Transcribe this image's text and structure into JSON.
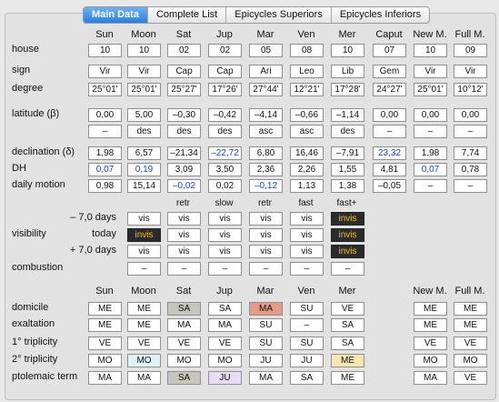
{
  "tabs": [
    "Main Data",
    "Complete List",
    "Epicycles Superiors",
    "Epicycles Inferiors"
  ],
  "columns": [
    "Sun",
    "Moon",
    "Sat",
    "Jup",
    "Mar",
    "Ven",
    "Mer",
    "Caput",
    "New M.",
    "Full M."
  ],
  "labels": {
    "house": "house",
    "sign": "sign",
    "degree": "degree",
    "latitude": "latitude (β)",
    "declination": "declination (δ)",
    "dh": "DH",
    "daily_motion": "daily motion",
    "visibility": "visibility",
    "combustion": "combustion"
  },
  "sublabels": {
    "minus": "– 7,0 days",
    "today": "today",
    "plus": "+ 7,0 days"
  },
  "rows": {
    "house": [
      "10",
      "10",
      "02",
      "02",
      "05",
      "08",
      "10",
      "07",
      "10",
      "09"
    ],
    "sign": [
      "Vir",
      "Vir",
      "Cap",
      "Cap",
      "Ari",
      "Leo",
      "Lib",
      "Gem",
      "Vir",
      "Vir"
    ],
    "degree": [
      "25°01'",
      "25°01'",
      "25°27'",
      "17°26'",
      "27°44'",
      "12°21'",
      "17°28'",
      "24°27'",
      "25°01'",
      "10°12'"
    ],
    "latitude": [
      "0,00",
      "5,00",
      "–0,30",
      "–0,42",
      "–4,14",
      "–0,66",
      "–1,14",
      "0,00",
      "0,00",
      "0,00"
    ],
    "latitude_dir": [
      "–",
      "des",
      "des",
      "des",
      "asc",
      "asc",
      "des",
      "–",
      "–",
      "–"
    ],
    "declination": [
      "1,98",
      "6,57",
      "–21,34",
      "–22,72",
      "6,80",
      "16,46",
      "–7,91",
      "23,32",
      "1,98",
      "7,74"
    ],
    "dh": [
      "0,07",
      "0,19",
      "3,09",
      "3,50",
      "2,36",
      "2,26",
      "1,55",
      "4,81",
      "0,07",
      "0,78"
    ],
    "daily_motion": [
      "0,98",
      "15,14",
      "–0,02",
      "0,02",
      "–0,12",
      "1,13",
      "1,38",
      "–0,05",
      "–",
      "–"
    ],
    "motion_state": [
      "",
      "",
      "retr",
      "slow",
      "retr",
      "fast",
      "fast+",
      "",
      "",
      ""
    ],
    "vis_minus": [
      "vis",
      "vis",
      "vis",
      "vis",
      "vis",
      "invis"
    ],
    "vis_today": [
      "invis",
      "vis",
      "vis",
      "vis",
      "vis",
      "invis"
    ],
    "vis_plus": [
      "vis",
      "vis",
      "vis",
      "vis",
      "vis",
      "invis"
    ],
    "combustion": [
      "–",
      "–",
      "–",
      "–",
      "–",
      "–"
    ]
  },
  "dignity_columns": [
    "Sun",
    "Moon",
    "Sat",
    "Jup",
    "Mar",
    "Ven",
    "Mer",
    "New M.",
    "Full M."
  ],
  "dignity_labels": {
    "domicile": "domicile",
    "exaltation": "exaltation",
    "triplicity1": "1° triplicity",
    "triplicity2": "2° triplicity",
    "term": "ptolemaic term"
  },
  "dignity": {
    "domicile": [
      "ME",
      "ME",
      "SA",
      "SA",
      "MA",
      "SU",
      "VE",
      "ME",
      "ME"
    ],
    "exaltation": [
      "ME",
      "ME",
      "MA",
      "MA",
      "SU",
      "–",
      "SA",
      "ME",
      "ME"
    ],
    "triplicity1": [
      "VE",
      "VE",
      "VE",
      "VE",
      "SU",
      "SU",
      "SA",
      "VE",
      "VE"
    ],
    "triplicity2": [
      "MO",
      "MO",
      "MO",
      "MO",
      "JU",
      "JU",
      "ME",
      "MO",
      "MO"
    ],
    "term": [
      "MA",
      "MA",
      "SA",
      "JU",
      "MA",
      "SA",
      "ME",
      "MA",
      "VE"
    ]
  },
  "colors": {
    "accent": "#2a7fe0",
    "blue_text": "#1d3fd8",
    "invis_bg": "#2b2b2b",
    "invis_fg": "#f4c000",
    "highlight_gray": "#c6c6bd",
    "highlight_salmon": "#e69a86",
    "highlight_cream": "#f7e6b2",
    "highlight_lavender": "#e7dcf6",
    "highlight_cyan": "#dcf3f7"
  }
}
